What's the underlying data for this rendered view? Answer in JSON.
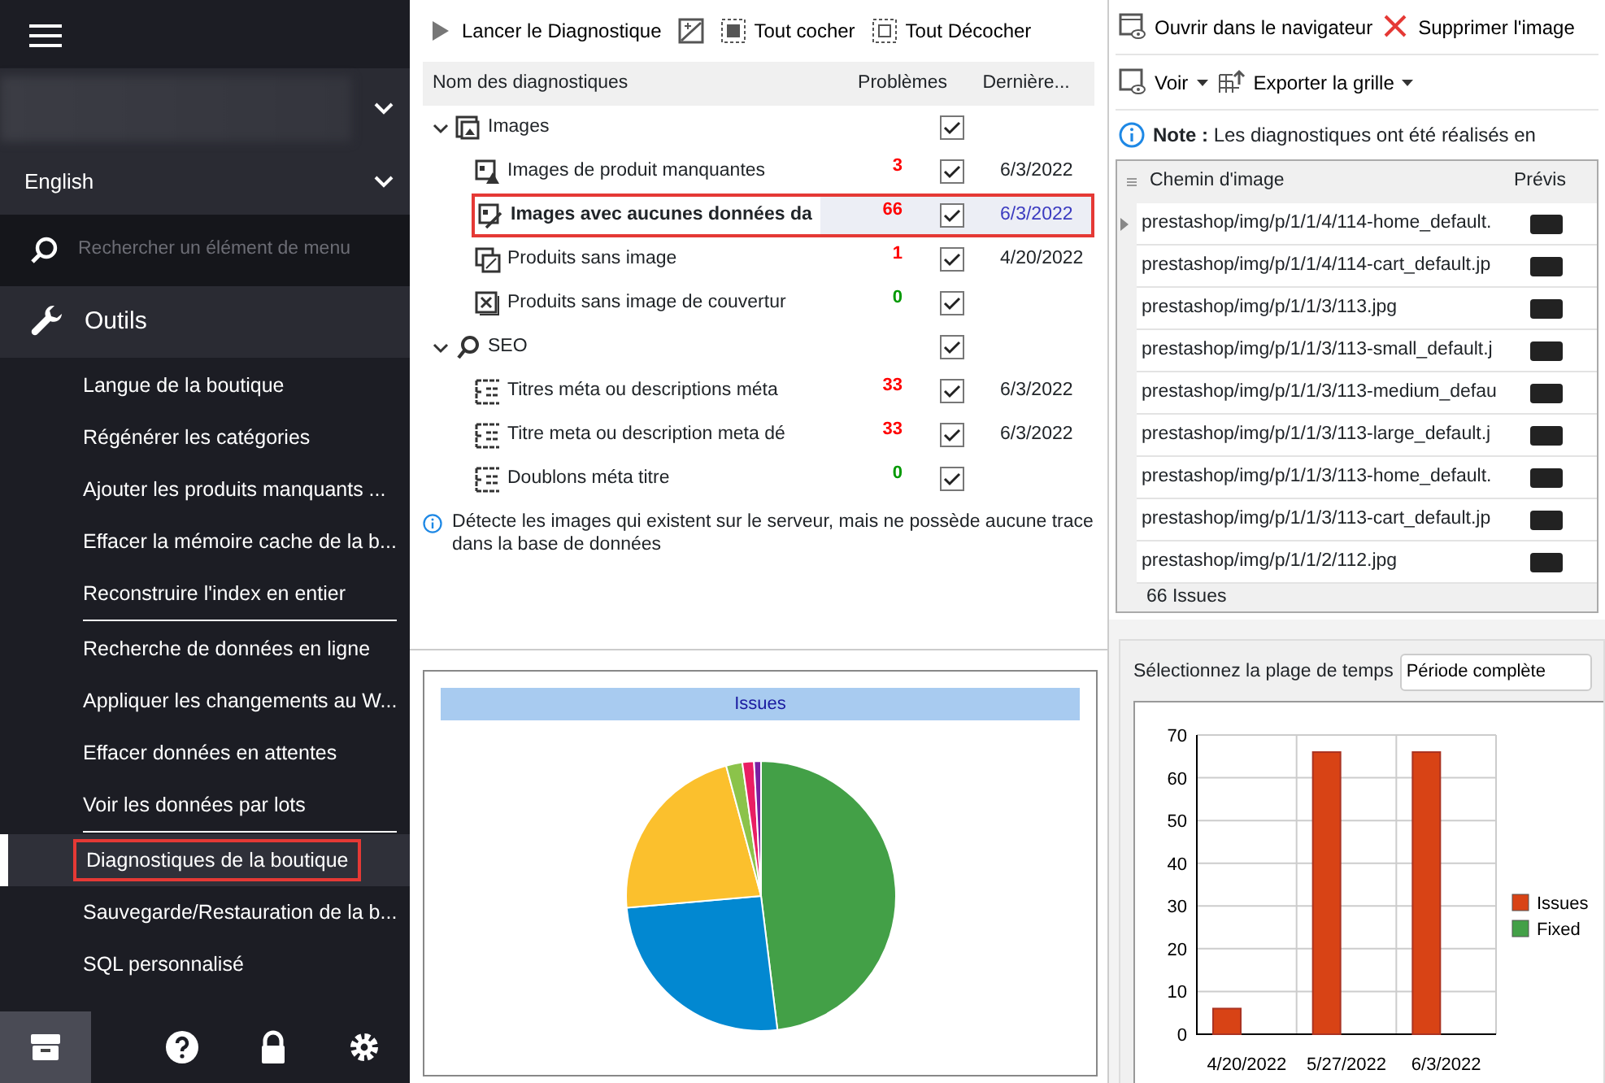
{
  "sidebar": {
    "store_selector": {
      "expanded": false
    },
    "language": {
      "label": "English"
    },
    "search": {
      "placeholder": "Rechercher un élément de menu"
    },
    "section": {
      "label": "Outils"
    },
    "items": [
      {
        "label": "Langue de la boutique",
        "selected": false,
        "divider_after": false
      },
      {
        "label": "Régénérer les catégories",
        "selected": false,
        "divider_after": false
      },
      {
        "label": "Ajouter les produits manquants ...",
        "selected": false,
        "divider_after": false
      },
      {
        "label": "Effacer la mémoire cache de la b...",
        "selected": false,
        "divider_after": false
      },
      {
        "label": "Reconstruire l'index en entier",
        "selected": false,
        "divider_after": true
      },
      {
        "label": "Recherche de données en ligne",
        "selected": false,
        "divider_after": false
      },
      {
        "label": "Appliquer les changements au W...",
        "selected": false,
        "divider_after": false
      },
      {
        "label": "Effacer données en attentes",
        "selected": false,
        "divider_after": false
      },
      {
        "label": "Voir les données par lots",
        "selected": false,
        "divider_after": true
      },
      {
        "label": "Diagnostiques de la boutique",
        "selected": true,
        "divider_after": false
      },
      {
        "label": "Sauvegarde/Restauration de la b...",
        "selected": false,
        "divider_after": false
      },
      {
        "label": "SQL personnalisé",
        "selected": false,
        "divider_after": false
      }
    ],
    "footer": [
      {
        "kind": "store",
        "selected": true
      },
      {
        "kind": "help",
        "selected": false
      },
      {
        "kind": "lock",
        "selected": false
      },
      {
        "kind": "settings",
        "selected": false
      }
    ]
  },
  "diagnostics": {
    "toolbar": [
      {
        "kind": "run",
        "label": "Lancer le Diagnostique"
      },
      {
        "kind": "image"
      },
      {
        "kind": "check",
        "label": "Tout cocher"
      },
      {
        "kind": "uncheck",
        "label": "Tout Décocher"
      }
    ],
    "columns": [
      "Nom des diagnostiques",
      "Problèmes",
      "Dernière..."
    ],
    "rows": [
      {
        "kind": "group",
        "label": "Images",
        "expanded": true,
        "checked": true
      },
      {
        "kind": "item",
        "label": "Images de produit manquantes",
        "issues": "3",
        "color": "#ff0000",
        "checked": true,
        "date": "6/3/2022",
        "selected": false
      },
      {
        "kind": "item",
        "label": "Images avec aucunes données da",
        "issues": "66",
        "color": "#ff0000",
        "checked": true,
        "date": "6/3/2022",
        "selected": true
      },
      {
        "kind": "item",
        "label": "Produits sans image",
        "issues": "1",
        "color": "#ff0000",
        "checked": true,
        "date": "4/20/2022",
        "selected": false
      },
      {
        "kind": "item",
        "label": "Produits sans image de couvertur",
        "issues": "0",
        "color": "#009900",
        "checked": true,
        "selected": false
      },
      {
        "kind": "group",
        "label": "SEO",
        "expanded": true,
        "checked": true
      },
      {
        "kind": "item",
        "label": "Titres méta ou descriptions méta",
        "issues": "33",
        "color": "#ff0000",
        "checked": true,
        "date": "6/3/2022",
        "selected": false
      },
      {
        "kind": "item",
        "label": "Titre meta ou description meta dé",
        "issues": "33",
        "color": "#ff0000",
        "checked": true,
        "date": "6/3/2022",
        "selected": false
      },
      {
        "kind": "item",
        "label": "Doublons méta titre",
        "issues": "0",
        "color": "#009900",
        "checked": true,
        "selected": false
      }
    ],
    "info": "Détecte les images qui existent sur le serveur, mais ne possède aucune trace dans la base de données"
  },
  "pie": {
    "title": "Issues"
  },
  "images": {
    "toolbar": [
      {
        "kind": "open",
        "label": "Ouvrir dans le navigateur"
      },
      {
        "kind": "delete",
        "label": "Supprimer l'image"
      },
      {
        "kind": "view",
        "label": "Voir"
      },
      {
        "kind": "export",
        "label": "Exporter la grille"
      }
    ],
    "note": "**Note :** Les diagnostiques ont été réalisés en",
    "columns": [
      "Chemin d'image",
      "Prévis"
    ],
    "rows": [
      {
        "path": "prestashop/img/p/1/1/4/114-home_default.",
        "current": true
      },
      {
        "path": "prestashop/img/p/1/1/4/114-cart_default.jp",
        "current": false
      },
      {
        "path": "prestashop/img/p/1/1/3/113.jpg",
        "current": false
      },
      {
        "path": "prestashop/img/p/1/1/3/113-small_default.j",
        "current": false
      },
      {
        "path": "prestashop/img/p/1/1/3/113-medium_defau",
        "current": false
      },
      {
        "path": "prestashop/img/p/1/1/3/113-large_default.j",
        "current": false
      },
      {
        "path": "prestashop/img/p/1/1/3/113-home_default.",
        "current": false
      },
      {
        "path": "prestashop/img/p/1/1/3/113-cart_default.jp",
        "current": false
      },
      {
        "path": "prestashop/img/p/1/1/2/112.jpg",
        "current": false
      }
    ],
    "footer": "66 Issues"
  },
  "history": {
    "range_label": "Sélectionnez la plage de temps",
    "range_value": "Période complète",
    "chart_data": {
      "type": "bar",
      "categories": [
        "4/20/2022",
        "5/27/2022",
        "6/3/2022"
      ],
      "series": [
        {
          "name": "Issues",
          "color": "#d84315",
          "values": [
            6,
            66,
            66
          ]
        },
        {
          "name": "Fixed",
          "color": "#43a047",
          "values": [
            0,
            0,
            0
          ]
        }
      ],
      "ylim": [
        0,
        70
      ],
      "yticks": [
        0,
        10,
        20,
        30,
        40,
        50,
        60,
        70
      ],
      "grid": true
    }
  }
}
